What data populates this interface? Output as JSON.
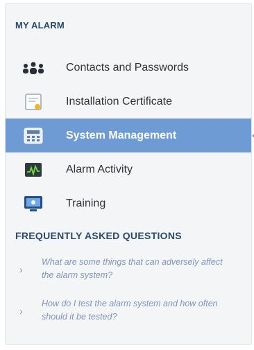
{
  "sections": {
    "my_alarm": "MY ALARM",
    "faq": "FREQUENTLY ASKED QUESTIONS"
  },
  "menu": [
    {
      "label": "Contacts and Passwords",
      "icon": "people-icon",
      "active": false
    },
    {
      "label": "Installation Certificate",
      "icon": "certificate-icon",
      "active": false
    },
    {
      "label": "System Management",
      "icon": "keypad-icon",
      "active": true
    },
    {
      "label": "Alarm Activity",
      "icon": "activity-monitor-icon",
      "active": false
    },
    {
      "label": "Training",
      "icon": "training-screen-icon",
      "active": false
    }
  ],
  "faq_items": [
    {
      "question": "What are some things that can adversely affect the alarm system?"
    },
    {
      "question": "How do I test the alarm system and how often should it be tested?"
    }
  ],
  "colors": {
    "active_bg": "#6f9bd4",
    "heading": "#284a70",
    "faq_link": "#7d95bd"
  }
}
